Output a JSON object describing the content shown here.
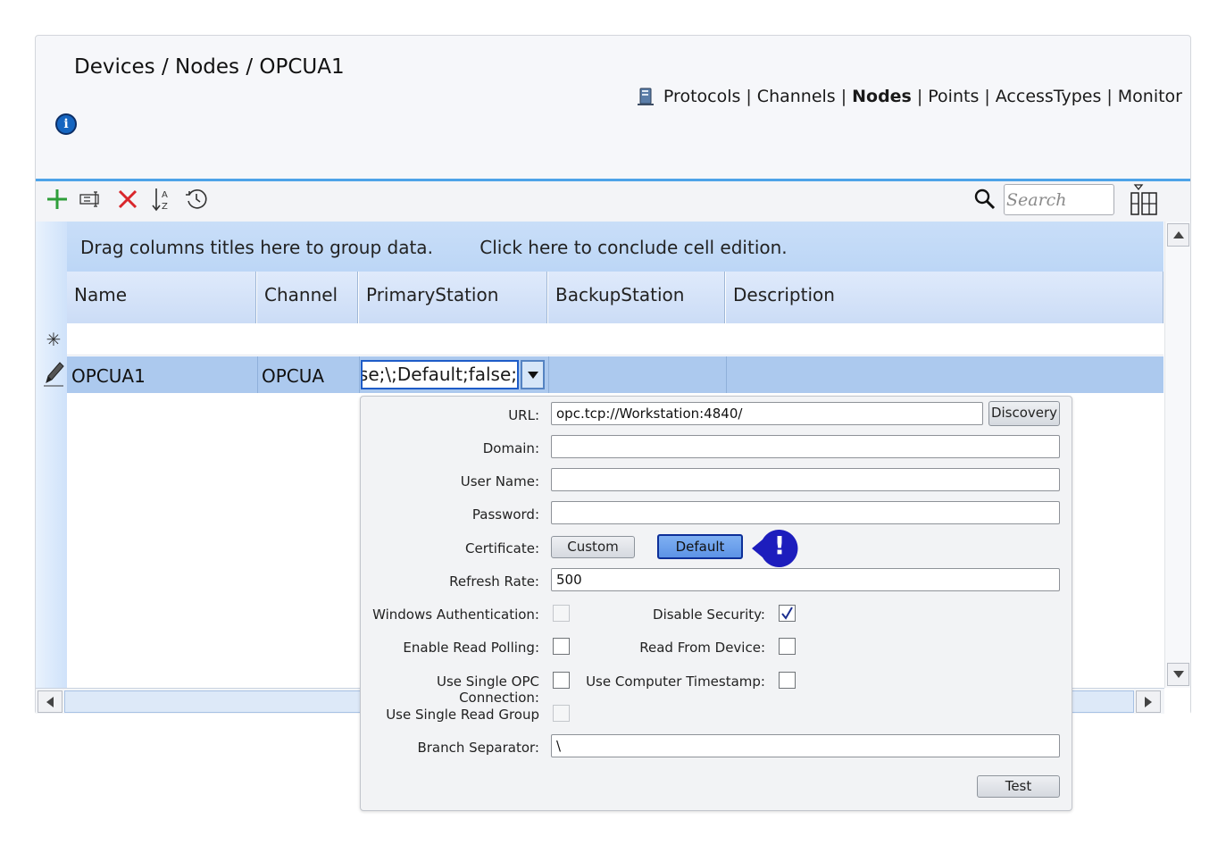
{
  "breadcrumb": "Devices / Nodes / OPCUA1",
  "nav": {
    "items": [
      "Protocols",
      "Channels",
      "Nodes",
      "Points",
      "AccessTypes",
      "Monitor"
    ],
    "separator": "|",
    "active": "Nodes"
  },
  "toolbar": {
    "search_placeholder": "Search"
  },
  "grid": {
    "group_hint": "Drag columns titles here to group data.",
    "conclude_hint": "Click here to conclude cell edition.",
    "new_row_marker": "✳",
    "columns": [
      "Name",
      "Channel",
      "PrimaryStation",
      "BackupStation",
      "Description"
    ],
    "row": {
      "name": "OPCUA1",
      "channel": "OPCUA",
      "primary_station": "ılse;\\;Default;false;"
    }
  },
  "popup": {
    "url_label": "URL:",
    "url_value": "opc.tcp://Workstation:4840/",
    "discovery_label": "Discovery",
    "domain_label": "Domain:",
    "domain_value": "",
    "username_label": "User Name:",
    "username_value": "",
    "password_label": "Password:",
    "password_value": "",
    "certificate_label": "Certificate:",
    "custom_label": "Custom",
    "default_label": "Default",
    "refresh_label": "Refresh Rate:",
    "refresh_value": "500",
    "win_auth_label": "Windows Authentication:",
    "disable_security_label": "Disable Security:",
    "read_polling_label": "Enable Read Polling:",
    "read_device_label": "Read From Device:",
    "single_opc_label": "Use Single OPC Connection:",
    "computer_ts_label": "Use Computer Timestamp:",
    "single_group_label": "Use Single Read Group",
    "branch_label": "Branch Separator:",
    "branch_value": "\\",
    "test_label": "Test",
    "checks": {
      "windows_authentication": false,
      "disable_security": true,
      "enable_read_polling": false,
      "read_from_device": false,
      "use_single_opc_connection": false,
      "use_computer_timestamp": false,
      "use_single_read_group": false
    }
  },
  "alert": "!",
  "colors": {
    "accent": "#4da3e8",
    "selected_row": "#acc9ee",
    "header_band": "#c9def8",
    "primary_button": "#5d93e6",
    "alert_badge": "#1d1dbd"
  }
}
